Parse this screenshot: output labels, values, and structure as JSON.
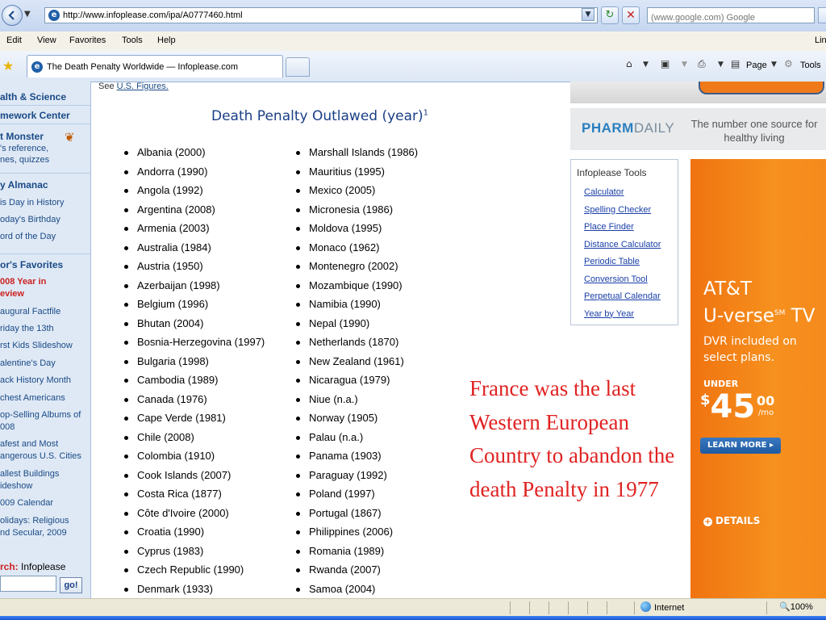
{
  "browser": {
    "url": "http://www.infoplease.com/ipa/A0777460.html",
    "search_placeholder": "(www.google.com) Google",
    "search_partial": "",
    "menu": [
      "Edit",
      "View",
      "Favorites",
      "Tools",
      "Help"
    ],
    "menu_right": "Lin",
    "tab_title": "The Death Penalty Worldwide — Infoplease.com",
    "toolbar": {
      "page_label": "Page",
      "tools_label": "Tools"
    },
    "status": {
      "zone": "Internet",
      "zoom": "100%"
    }
  },
  "leftnav": {
    "items": [
      {
        "text": "alth & Science",
        "type": "section"
      },
      {
        "text": "mework Center",
        "type": "section"
      },
      {
        "text": "t Monster",
        "type": "section"
      },
      {
        "text": "'s reference,",
        "type": "item"
      },
      {
        "text": "nes, quizzes",
        "type": "item"
      },
      {
        "text": "y Almanac",
        "type": "section"
      },
      {
        "text": "is Day in History",
        "type": "item"
      },
      {
        "text": "oday's Birthday",
        "type": "item"
      },
      {
        "text": "ord of the Day",
        "type": "item"
      },
      {
        "text": "or's Favorites",
        "type": "section"
      },
      {
        "text": "008 Year in",
        "type": "red"
      },
      {
        "text": "eview",
        "type": "red"
      },
      {
        "text": "augural Factfile",
        "type": "item"
      },
      {
        "text": "riday the 13th",
        "type": "item"
      },
      {
        "text": "rst Kids Slideshow",
        "type": "item"
      },
      {
        "text": "alentine's Day",
        "type": "item"
      },
      {
        "text": "ack History Month",
        "type": "item"
      },
      {
        "text": "chest Americans",
        "type": "item"
      },
      {
        "text": "op-Selling Albums of",
        "type": "item"
      },
      {
        "text": "008",
        "type": "item"
      },
      {
        "text": "afest and Most",
        "type": "item"
      },
      {
        "text": "angerous U.S. Cities",
        "type": "item"
      },
      {
        "text": "allest Buildings",
        "type": "item"
      },
      {
        "text": "ideshow",
        "type": "item"
      },
      {
        "text": "009 Calendar",
        "type": "item"
      },
      {
        "text": "olidays: Religious",
        "type": "item"
      },
      {
        "text": "nd Secular, 2009",
        "type": "item"
      }
    ],
    "search_label_prefix": "rch:",
    "search_label_site": "Infoplease",
    "go_label": "go!"
  },
  "main": {
    "top_fragment_prefix": "See ",
    "top_fragment_link": "U.S. Figures.",
    "heading": "Death Penalty Outlawed (year)",
    "heading_sup": "1",
    "col1": [
      "Albania (2000)",
      "Andorra (1990)",
      "Angola (1992)",
      "Argentina (2008)",
      "Armenia (2003)",
      "Australia (1984)",
      "Austria (1950)",
      "Azerbaijan (1998)",
      "Belgium (1996)",
      "Bhutan (2004)",
      "Bosnia-Herzegovina (1997)",
      "Bulgaria (1998)",
      "Cambodia (1989)",
      "Canada (1976)",
      "Cape Verde (1981)",
      "Chile (2008)",
      "Colombia (1910)",
      "Cook Islands (2007)",
      "Costa Rica (1877)",
      "Côte d'Ivoire (2000)",
      "Croatia (1990)",
      "Cyprus (1983)",
      "Czech Republic (1990)",
      "Denmark (1933)"
    ],
    "col2": [
      "Marshall Islands (1986)",
      "Mauritius (1995)",
      "Mexico (2005)",
      "Micronesia (1986)",
      "Moldova (1995)",
      "Monaco (1962)",
      "Montenegro (2002)",
      "Mozambique (1990)",
      "Namibia (1990)",
      "Nepal (1990)",
      "Netherlands (1870)",
      "New Zealand (1961)",
      "Nicaragua (1979)",
      "Niue (n.a.)",
      "Norway (1905)",
      "Palau (n.a.)",
      "Panama (1903)",
      "Paraguay (1992)",
      "Poland (1997)",
      "Portugal (1867)",
      "Philippines (2006)",
      "Romania (1989)",
      "Rwanda (2007)",
      "Samoa (2004)"
    ],
    "overlay": "France was the last Western European Country to abandon the death Penalty in 1977"
  },
  "right": {
    "pharm_logo_a": "PHARM",
    "pharm_logo_b": "DAILY",
    "pharm_tagline": "The number one source for healthy living",
    "tools_title": "Infoplease Tools",
    "tools": [
      "Calculator",
      "Spelling Checker",
      "Place Finder",
      "Distance Calculator",
      "Periodic Table",
      "Conversion Tool",
      "Perpetual Calendar",
      "Year by Year"
    ],
    "ad": {
      "brand_line1": "AT&T",
      "brand_line2": "U-verse",
      "brand_sm": "SM",
      "brand_tv": "TV",
      "dvr": "DVR included on select plans.",
      "under": "UNDER",
      "dollar": "$",
      "price": "45",
      "cents": "00",
      "per": "/mo",
      "learn": "LEARN MORE ▸",
      "details": "DETAILS"
    },
    "colors": {
      "accent_orange": "#f07a1a",
      "link_blue": "#1a3fa8",
      "overlay_red": "#e02222"
    }
  }
}
